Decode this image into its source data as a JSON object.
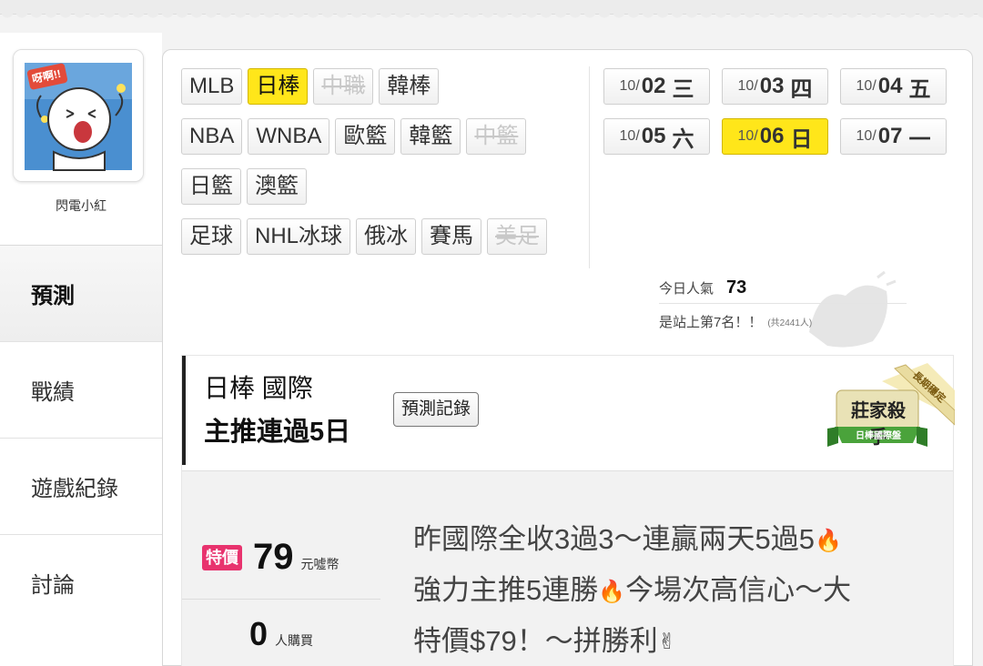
{
  "user": {
    "name": "閃電小紅",
    "avatar_text": "呀啊!!"
  },
  "nav": [
    {
      "label": "預測",
      "active": true
    },
    {
      "label": "戰績",
      "active": false
    },
    {
      "label": "遊戲紀錄",
      "active": false
    },
    {
      "label": "討論",
      "active": false
    }
  ],
  "league_rows": [
    [
      {
        "label": "MLB",
        "state": "normal"
      },
      {
        "label": "日棒",
        "state": "selected"
      },
      {
        "label": "中職",
        "state": "disabled"
      },
      {
        "label": "韓棒",
        "state": "normal"
      }
    ],
    [
      {
        "label": "NBA",
        "state": "normal"
      },
      {
        "label": "WNBA",
        "state": "normal"
      },
      {
        "label": "歐籃",
        "state": "normal"
      },
      {
        "label": "韓籃",
        "state": "normal"
      },
      {
        "label": "中籃",
        "state": "disabled"
      }
    ],
    [
      {
        "label": "日籃",
        "state": "normal"
      },
      {
        "label": "澳籃",
        "state": "normal"
      }
    ],
    [
      {
        "label": "足球",
        "state": "normal"
      },
      {
        "label": "NHL冰球",
        "state": "normal"
      },
      {
        "label": "俄冰",
        "state": "normal"
      },
      {
        "label": "賽馬",
        "state": "normal"
      },
      {
        "label": "美足",
        "state": "disabled"
      }
    ]
  ],
  "dates": [
    {
      "md": "10/",
      "day": "02",
      "weekday": "三",
      "selected": false
    },
    {
      "md": "10/",
      "day": "03",
      "weekday": "四",
      "selected": false
    },
    {
      "md": "10/",
      "day": "04",
      "weekday": "五",
      "selected": false
    },
    {
      "md": "10/",
      "day": "05",
      "weekday": "六",
      "selected": false
    },
    {
      "md": "10/",
      "day": "06",
      "weekday": "日",
      "selected": true
    },
    {
      "md": "10/",
      "day": "07",
      "weekday": "一",
      "selected": false
    }
  ],
  "popularity": {
    "label": "今日人氣",
    "value": "73",
    "rank_text": "是站上第7名！！",
    "total_text": "(共2441人)"
  },
  "prediction": {
    "title": "日棒 國際",
    "subtitle": "主推連過5日",
    "record_button": "預測記錄",
    "badge_title": "莊家殺手",
    "badge_sub": "日棒國際盤",
    "badge_ribbon": "長期穩定",
    "price_tag": "特價",
    "price": "79",
    "price_unit": "元噓幣",
    "buyers": "0",
    "buyers_unit": "人購買",
    "desc_line1": "昨國際全收3過3～連贏兩天5過5",
    "desc_line2_a": "強力主推5連勝",
    "desc_line2_b": "今場次高信心～大",
    "desc_line3": "特價$79！～拼勝利"
  },
  "colors": {
    "highlight": "#ffe61a",
    "price_tag": "#e8336e"
  }
}
